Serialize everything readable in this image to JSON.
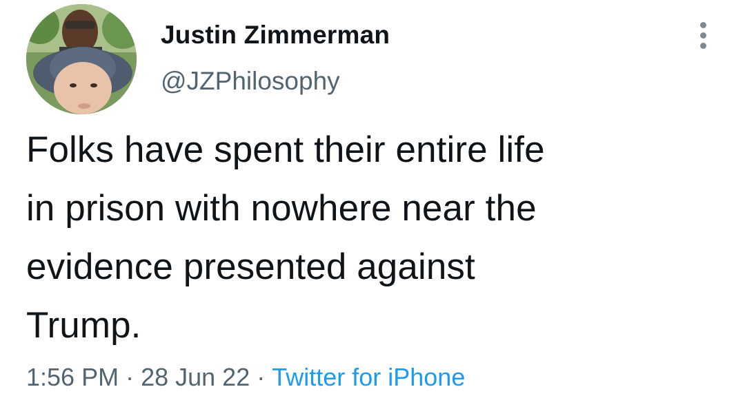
{
  "author": {
    "display_name": "Justin Zimmerman",
    "handle": "@JZPhilosophy",
    "avatar_icon": "avatar-photo"
  },
  "tweet": {
    "text": "Folks have spent their entire life\nin prison with nowhere near the\nevidence presented against\nTrump."
  },
  "meta": {
    "time": "1:56 PM",
    "separator": "·",
    "date": "28 Jun 22",
    "source": "Twitter for iPhone"
  },
  "colors": {
    "text": "#0f1419",
    "secondary": "#536471",
    "link": "#1d9bf0"
  },
  "icons": {
    "more": "more-vertical-icon"
  }
}
